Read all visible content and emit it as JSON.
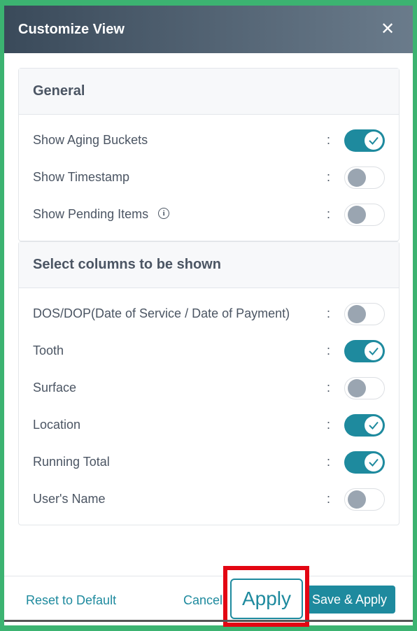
{
  "dialog": {
    "title": "Customize View",
    "close_icon": "close-icon"
  },
  "general": {
    "heading": "General",
    "rows": [
      {
        "label": "Show Aging Buckets",
        "colon": ":",
        "on": true
      },
      {
        "label": "Show Timestamp",
        "colon": ":",
        "on": false
      },
      {
        "label": "Show Pending Items",
        "colon": ":",
        "on": false,
        "info_icon": "info-icon",
        "info_glyph": "i"
      }
    ]
  },
  "columns": {
    "heading": "Select columns to be shown",
    "rows": [
      {
        "label": "DOS/DOP(Date of Service / Date of Payment)",
        "colon": ":",
        "on": false
      },
      {
        "label": "Tooth",
        "colon": ":",
        "on": true
      },
      {
        "label": "Surface",
        "colon": ":",
        "on": false
      },
      {
        "label": "Location",
        "colon": ":",
        "on": true
      },
      {
        "label": "Running Total",
        "colon": ":",
        "on": true
      },
      {
        "label": "User's Name",
        "colon": ":",
        "on": false
      }
    ]
  },
  "footer": {
    "reset_label": "Reset to Default",
    "cancel_label": "Cancel",
    "apply_label": "Apply",
    "save_apply_label": "Save & Apply"
  },
  "colors": {
    "accent": "#1e8a9e",
    "highlight": "#e30613",
    "frame": "#3cb371"
  }
}
